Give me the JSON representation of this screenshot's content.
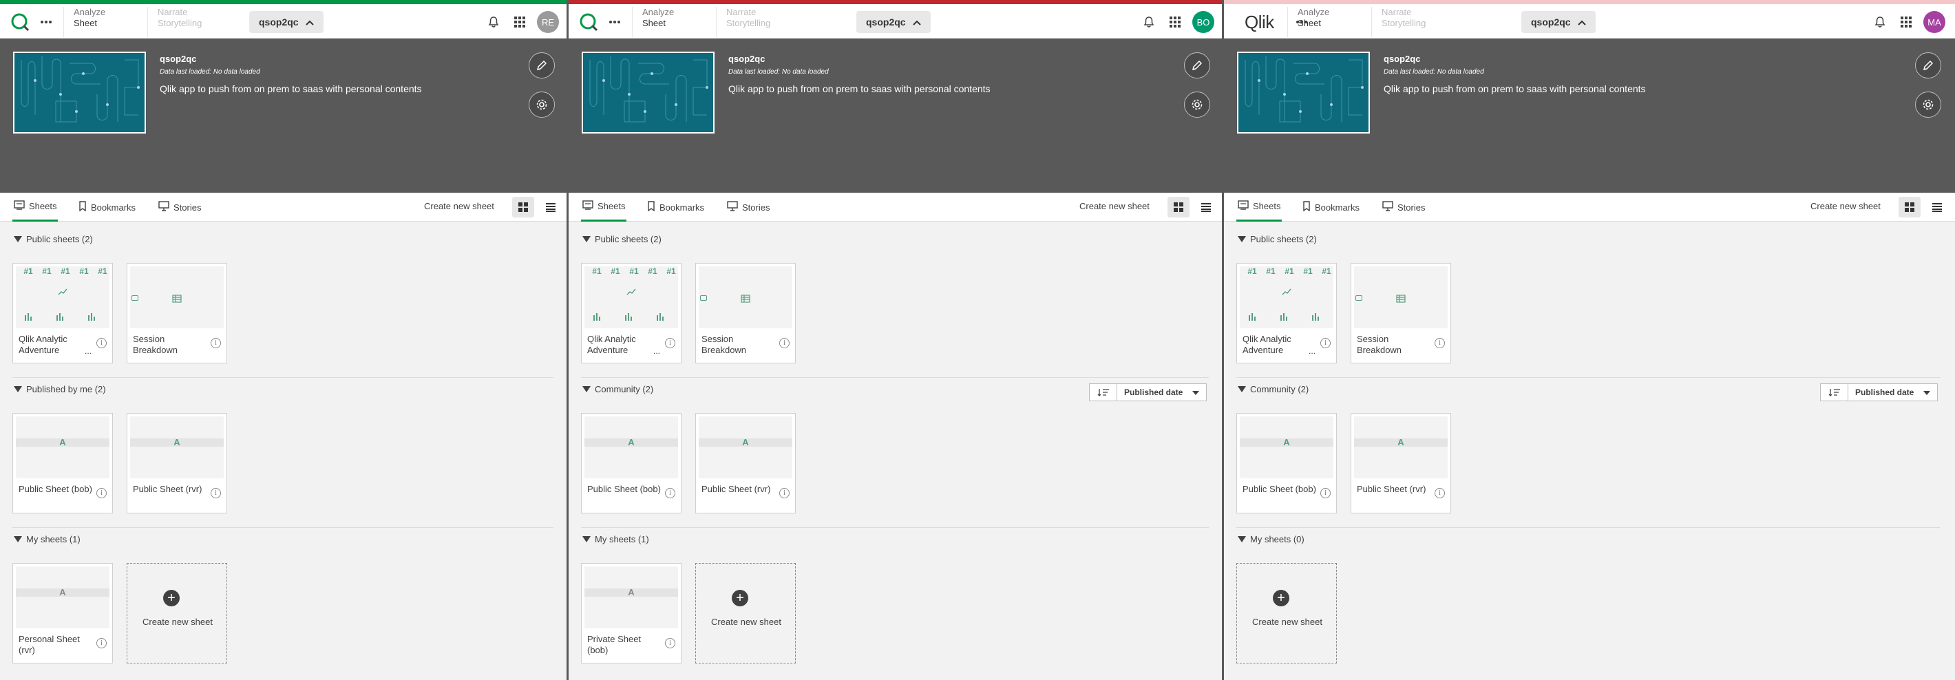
{
  "panels": [
    {
      "top_color": "#009845",
      "logo": "q-icon",
      "analyze_small": "Analyze",
      "analyze_main": "Sheet",
      "narrate_small": "Narrate",
      "narrate_main": "Storytelling",
      "app_name": "qsop2qc",
      "avatar_initials": "RE",
      "avatar_color": "#9a9a9a",
      "hero_title": "qsop2qc",
      "hero_status": "Data last loaded: No data loaded",
      "hero_desc": "Qlik app to push from on prem to saas with personal contents",
      "tabs": [
        "Sheets",
        "Bookmarks",
        "Stories"
      ],
      "create_new_sheet": "Create new sheet",
      "sections": [
        {
          "title": "Public sheets (2)"
        },
        {
          "title": "Published by me (2)"
        },
        {
          "title": "My sheets (1)"
        }
      ],
      "public_cards": [
        {
          "title": "Qlik Analytic Adventure",
          "ellipsis": "..."
        },
        {
          "title": "Session Breakdown"
        }
      ],
      "community_cards": [
        {
          "title": "Public Sheet (bob)"
        },
        {
          "title": "Public Sheet (rvr)"
        }
      ],
      "my_cards": [
        {
          "title": "Personal Sheet (rvr)"
        }
      ],
      "sort": null,
      "new_card": "Create new sheet"
    },
    {
      "top_color": "#c0282d",
      "logo": "q-icon",
      "analyze_small": "Analyze",
      "analyze_main": "Sheet",
      "narrate_small": "Narrate",
      "narrate_main": "Storytelling",
      "app_name": "qsop2qc",
      "avatar_initials": "BO",
      "avatar_color": "#009a6e",
      "hero_title": "qsop2qc",
      "hero_status": "Data last loaded: No data loaded",
      "hero_desc": "Qlik app to push from on prem to saas with personal contents",
      "tabs": [
        "Sheets",
        "Bookmarks",
        "Stories"
      ],
      "create_new_sheet": "Create new sheet",
      "sections": [
        {
          "title": "Public sheets (2)"
        },
        {
          "title": "Community (2)"
        },
        {
          "title": "My sheets (1)"
        }
      ],
      "public_cards": [
        {
          "title": "Qlik Analytic Adventure",
          "ellipsis": "..."
        },
        {
          "title": "Session Breakdown"
        }
      ],
      "community_cards": [
        {
          "title": "Public Sheet (bob)"
        },
        {
          "title": "Public Sheet (rvr)"
        }
      ],
      "my_cards": [
        {
          "title": "Private Sheet (bob)"
        }
      ],
      "sort": "Published date",
      "new_card": "Create new sheet"
    },
    {
      "top_color": "#f5c6c8",
      "logo": "qlik-wordmark",
      "logo_text": "Qlik",
      "analyze_small": "Analyze",
      "analyze_main": "Sheet",
      "narrate_small": "Narrate",
      "narrate_main": "Storytelling",
      "app_name": "qsop2qc",
      "avatar_initials": "MA",
      "avatar_color": "#a53fa0",
      "hero_title": "qsop2qc",
      "hero_status": "Data last loaded: No data loaded",
      "hero_desc": "Qlik app to push from on prem to saas with personal contents",
      "tabs": [
        "Sheets",
        "Bookmarks",
        "Stories"
      ],
      "create_new_sheet": "Create new sheet",
      "sections": [
        {
          "title": "Public sheets (2)"
        },
        {
          "title": "Community (2)"
        },
        {
          "title": "My sheets (0)"
        }
      ],
      "public_cards": [
        {
          "title": "Qlik Analytic Adventure",
          "ellipsis": "..."
        },
        {
          "title": "Session Breakdown"
        }
      ],
      "community_cards": [
        {
          "title": "Public Sheet (bob)"
        },
        {
          "title": "Public Sheet (rvr)"
        }
      ],
      "my_cards": [],
      "sort": "Published date",
      "new_card": "Create new sheet"
    }
  ],
  "kpi_label": "#1",
  "sheet_letter": "A",
  "info_glyph": "i"
}
